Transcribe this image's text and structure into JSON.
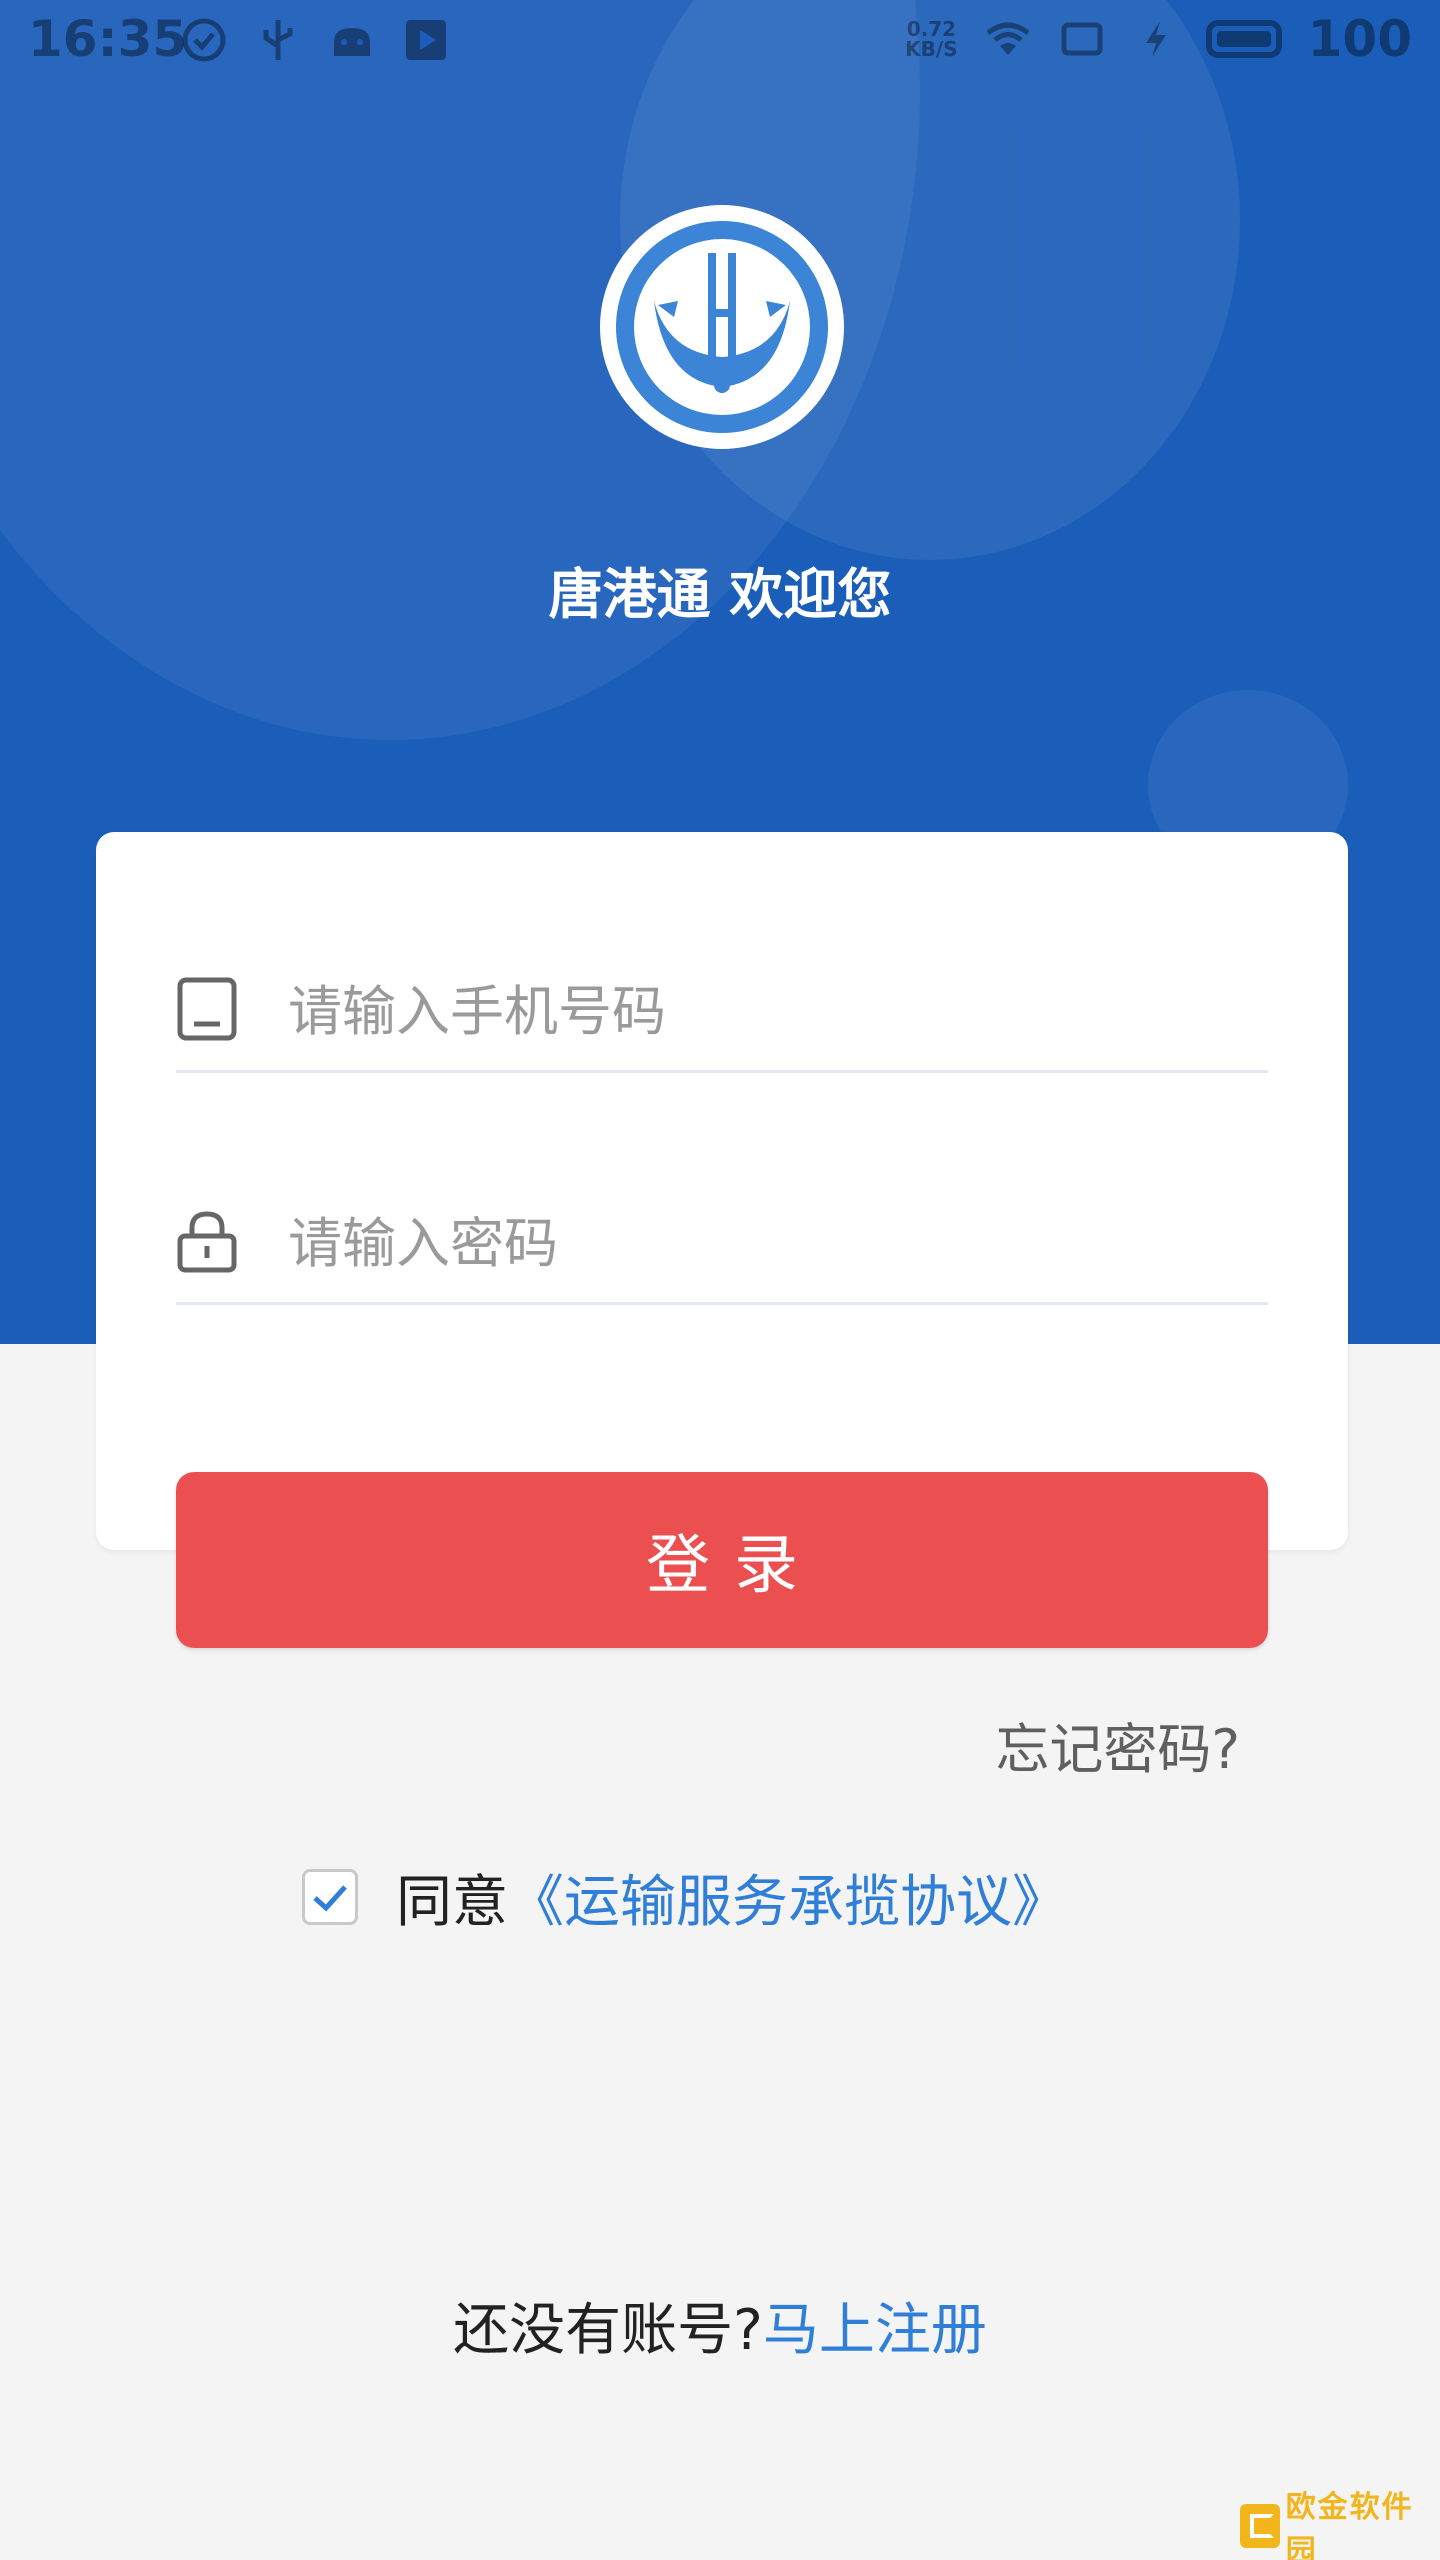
{
  "status_bar": {
    "time": "16:35",
    "net_speed_value": "0.72",
    "net_speed_unit": "KB/S",
    "battery": "100"
  },
  "header": {
    "welcome": "唐港通 欢迎您"
  },
  "login": {
    "phone_placeholder": "请输入手机号码",
    "password_placeholder": "请输入密码",
    "login_button": "登录",
    "forgot_password": "忘记密码?"
  },
  "agreement": {
    "checked": true,
    "agree_label": "同意",
    "link": "《运输服务承揽协议》"
  },
  "register": {
    "prompt": "还没有账号?",
    "link": "马上注册"
  },
  "colors": {
    "brand_blue": "#1b5eb9",
    "button_red": "#ec4f50",
    "link_blue": "#2f7ed8"
  },
  "watermark": {
    "text": "欧金软件园"
  }
}
